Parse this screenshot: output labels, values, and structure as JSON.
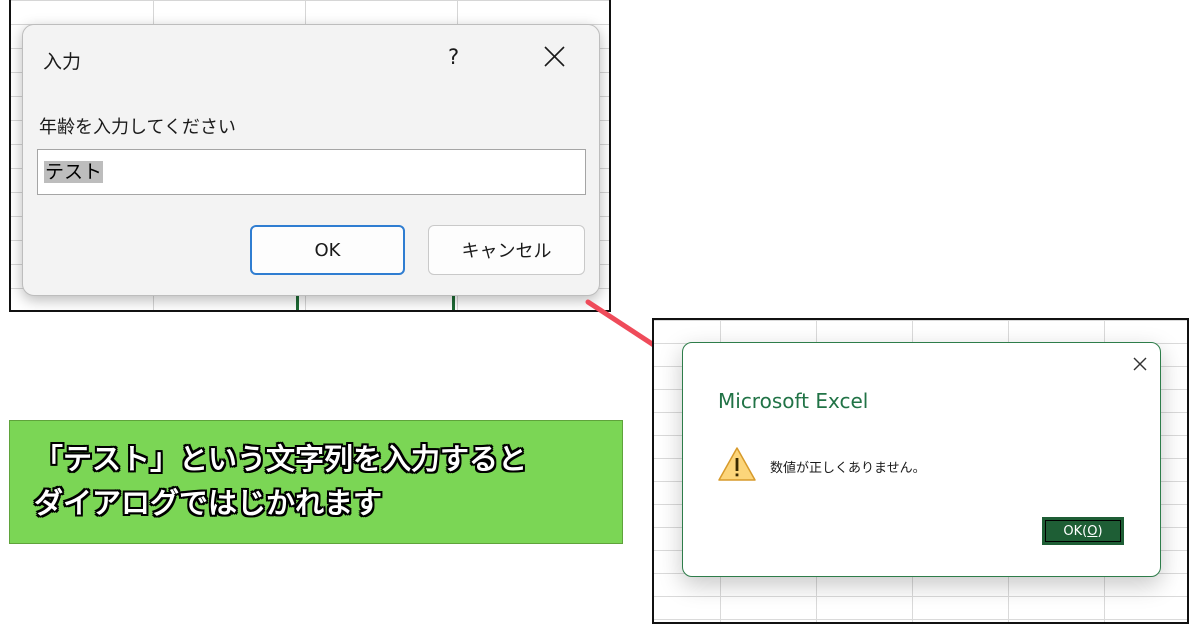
{
  "input_dialog": {
    "title": "入力",
    "help_label": "?",
    "prompt": "年齢を入力してください",
    "input_value": "テスト",
    "ok_label": "OK",
    "cancel_label": "キャンセル"
  },
  "caption": {
    "line1": "「テスト」という文字列を入力すると",
    "line2": "ダイアログではじかれます",
    "background": "#7bd655"
  },
  "error_dialog": {
    "title": "Microsoft Excel",
    "icon": "warning-icon",
    "message": "数値が正しくありません。",
    "ok_label_prefix": "OK(",
    "ok_label_key": "O",
    "ok_label_suffix": ")",
    "accent": "#217346"
  },
  "arrow_color": "#ef4b5a"
}
